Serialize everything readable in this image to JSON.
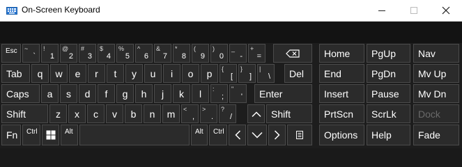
{
  "window": {
    "title": "On-Screen Keyboard",
    "min_glyph": "—",
    "max_glyph": "☐",
    "close_glyph": "✕"
  },
  "colors": {
    "background": "#1d1d1d",
    "key": "#2b2b2b",
    "key_border": "#4b4b4b",
    "text": "#ffffff",
    "disabled_text": "#6a6a6a"
  },
  "main_keys": {
    "row1": {
      "esc": "Esc",
      "keys": [
        [
          "~",
          "`"
        ],
        [
          "!",
          "1"
        ],
        [
          "@",
          "2"
        ],
        [
          "#",
          "3"
        ],
        [
          "$",
          "4"
        ],
        [
          "%",
          "5"
        ],
        [
          "^",
          "6"
        ],
        [
          "&",
          "7"
        ],
        [
          "*",
          "8"
        ],
        [
          "(",
          "9"
        ],
        [
          ")",
          "0"
        ],
        [
          "_",
          "-"
        ],
        [
          "+",
          "="
        ]
      ],
      "backspace_icon": "backspace-icon"
    },
    "row2": {
      "tab": "Tab",
      "letters": [
        "q",
        "w",
        "e",
        "r",
        "t",
        "y",
        "u",
        "i",
        "o",
        "p"
      ],
      "pairs": [
        [
          "{",
          "["
        ],
        [
          "}",
          "]"
        ],
        [
          "|",
          "\\"
        ]
      ],
      "del": "Del"
    },
    "row3": {
      "caps": "Caps",
      "letters": [
        "a",
        "s",
        "d",
        "f",
        "g",
        "h",
        "j",
        "k",
        "l"
      ],
      "pairs": [
        [
          ":",
          ";"
        ],
        [
          "\"",
          "'"
        ]
      ],
      "enter": "Enter"
    },
    "row4": {
      "shift_left": "Shift",
      "letters": [
        "z",
        "x",
        "c",
        "v",
        "b",
        "n",
        "m"
      ],
      "pairs": [
        [
          "<",
          ","
        ],
        [
          ">",
          "."
        ],
        [
          "?",
          "/"
        ]
      ],
      "up_icon": "chevron-up-icon",
      "shift_right": "Shift"
    },
    "row5": {
      "fn": "Fn",
      "ctrl_left": "Ctrl",
      "win_icon": "windows-logo-icon",
      "alt_left": "Alt",
      "alt_right": "Alt",
      "ctrl_right": "Ctrl",
      "left_icon": "chevron-left-icon",
      "down_icon": "chevron-down-icon",
      "right_icon": "chevron-right-icon",
      "menu_icon": "context-menu-icon"
    }
  },
  "nav_keys": {
    "col1": [
      "Home",
      "End",
      "Insert",
      "PrtScn",
      "Options"
    ],
    "col2": [
      "PgUp",
      "PgDn",
      "Pause",
      "ScrLk",
      "Help"
    ],
    "col3": [
      "Nav",
      "Mv Up",
      "Mv Dn",
      "Dock",
      "Fade"
    ]
  }
}
